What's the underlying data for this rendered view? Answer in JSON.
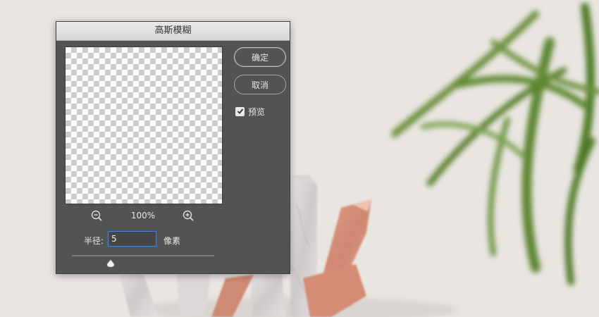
{
  "dialog": {
    "title": "高斯模糊",
    "ok_label": "确定",
    "cancel_label": "取消",
    "preview_label": "预览",
    "preview_checked": true,
    "zoom_value": "100%",
    "radius_label": "半径:",
    "radius_value": "5",
    "unit_label": "像素",
    "slider_fraction": 0.27
  },
  "colors": {
    "dialog_bg": "#535353",
    "focus_ring": "#3f87d9",
    "background_wall": "#e9e5e1",
    "copper": "#d58f78"
  }
}
